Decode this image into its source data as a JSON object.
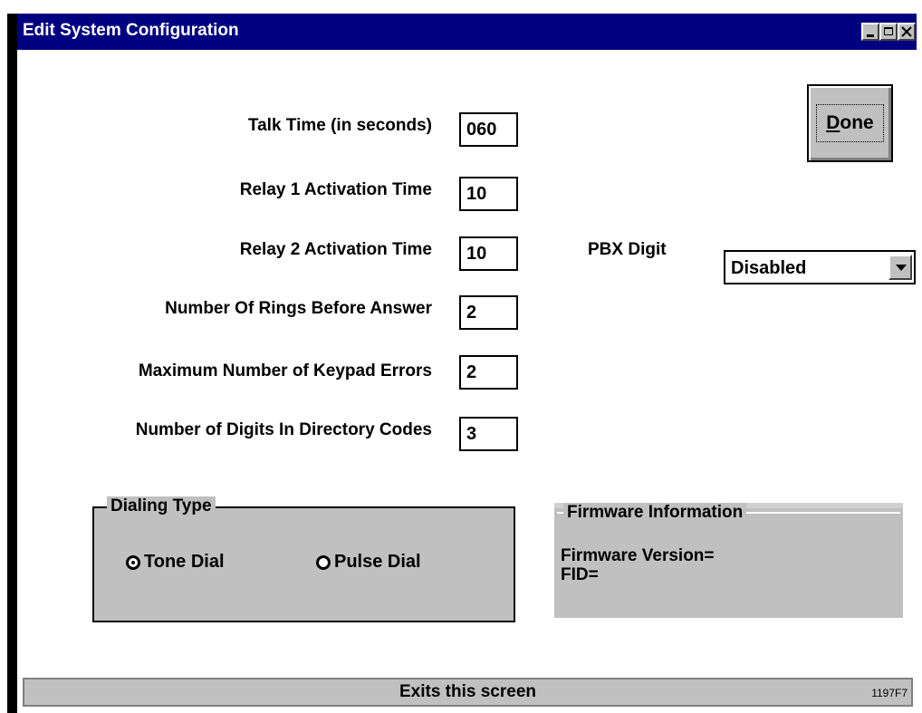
{
  "window": {
    "title": "Edit System Configuration"
  },
  "buttons": {
    "done_label": "one",
    "done_mnemonic": "D"
  },
  "fields": [
    {
      "label": "Talk Time (in seconds)",
      "value": "060"
    },
    {
      "label": "Relay 1 Activation Time",
      "value": "10"
    },
    {
      "label": "Relay 2 Activation Time",
      "value": "10"
    },
    {
      "label": "Number Of Rings Before Answer",
      "value": "2"
    },
    {
      "label": "Maximum Number of Keypad Errors",
      "value": "2"
    },
    {
      "label": "Number of Digits In Directory Codes",
      "value": "3"
    }
  ],
  "pbx": {
    "label": "PBX Digit",
    "value": "Disabled"
  },
  "dialing": {
    "title": "Dialing Type",
    "options": [
      "Tone Dial",
      "Pulse Dial"
    ],
    "selected": "Tone Dial"
  },
  "firmware": {
    "title": "Firmware Information",
    "version_label": "Firmware Version=",
    "fid_label": "FID="
  },
  "status": {
    "text": "Exits this screen",
    "code": "1197F7"
  },
  "icons": [
    "minimize-icon",
    "maximize-icon",
    "close-icon",
    "chevron-down-icon"
  ]
}
